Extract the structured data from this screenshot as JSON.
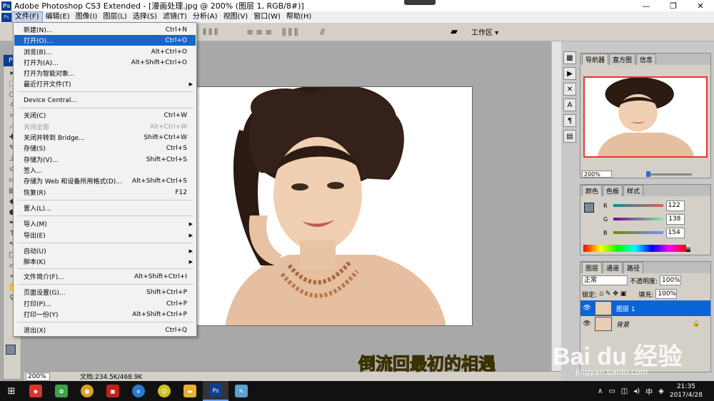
{
  "window": {
    "title": "Adobe Photoshop CS3 Extended - [漫画处理.jpg @ 200% (图层 1, RGB/8#)]",
    "app_icon": "Ps",
    "minimize": "—",
    "maximize": "❐",
    "close": "✕"
  },
  "menubar": {
    "items": [
      "文件(F)",
      "编辑(E)",
      "图像(I)",
      "图层(L)",
      "选择(S)",
      "滤镜(T)",
      "分析(A)",
      "视图(V)",
      "窗口(W)",
      "帮助(H)"
    ]
  },
  "optionsbar": {
    "workspace_label": "工作区 ▾"
  },
  "file_menu": {
    "items": [
      {
        "label": "新建(N)...",
        "shortcut": "Ctrl+N"
      },
      {
        "label": "打开(O)...",
        "shortcut": "Ctrl+O",
        "highlighted": true
      },
      {
        "label": "浏览(B)...",
        "shortcut": "Alt+Ctrl+O"
      },
      {
        "label": "打开为(A)...",
        "shortcut": "Alt+Shift+Ctrl+O"
      },
      {
        "label": "打开为智能对象...",
        "shortcut": ""
      },
      {
        "label": "最近打开文件(T)",
        "shortcut": "",
        "submenu": true
      },
      {
        "label": "Device Central...",
        "shortcut": ""
      },
      {
        "label": "关闭(C)",
        "shortcut": "Ctrl+W"
      },
      {
        "label": "关闭全部",
        "shortcut": "Alt+Ctrl+W",
        "disabled": true
      },
      {
        "label": "关闭并转到 Bridge...",
        "shortcut": "Shift+Ctrl+W"
      },
      {
        "label": "存储(S)",
        "shortcut": "Ctrl+S"
      },
      {
        "label": "存储为(V)...",
        "shortcut": "Shift+Ctrl+S"
      },
      {
        "label": "签入...",
        "shortcut": ""
      },
      {
        "label": "存储为 Web 和设备所用格式(D)...",
        "shortcut": "Alt+Shift+Ctrl+S"
      },
      {
        "label": "恢复(R)",
        "shortcut": "F12"
      },
      {
        "label": "置入(L)...",
        "shortcut": ""
      },
      {
        "label": "导入(M)",
        "shortcut": "",
        "submenu": true
      },
      {
        "label": "导出(E)",
        "shortcut": "",
        "submenu": true
      },
      {
        "label": "自动(U)",
        "shortcut": "",
        "submenu": true
      },
      {
        "label": "脚本(K)",
        "shortcut": "",
        "submenu": true
      },
      {
        "label": "文件简介(F)...",
        "shortcut": "Alt+Shift+Ctrl+I"
      },
      {
        "label": "页面设置(G)...",
        "shortcut": "Shift+Ctrl+P"
      },
      {
        "label": "打印(P)...",
        "shortcut": "Ctrl+P"
      },
      {
        "label": "打印一份(Y)",
        "shortcut": "Alt+Shift+Ctrl+P"
      },
      {
        "label": "退出(X)",
        "shortcut": "Ctrl+Q"
      }
    ]
  },
  "document": {
    "zoom": "200%",
    "info": "文档:234.5K/468.9K"
  },
  "navigator": {
    "tabs": [
      "导航器",
      "直方图",
      "信息"
    ],
    "zoom": "200%"
  },
  "color_panel": {
    "tabs": [
      "颜色",
      "色板",
      "样式"
    ],
    "foreground_color": "#7a8a9a",
    "channels": [
      {
        "label": "R",
        "value": "122",
        "color": "#d04040"
      },
      {
        "label": "G",
        "value": "138",
        "color": "#40a040"
      },
      {
        "label": "B",
        "value": "154",
        "color": "#4040d0"
      }
    ]
  },
  "layers_panel": {
    "tabs": [
      "图层",
      "通道",
      "路径"
    ],
    "blend_mode": "正常",
    "opacity_label": "不透明度:",
    "opacity": "100%",
    "lock_label": "锁定:",
    "fill_label": "填充:",
    "fill": "100%",
    "layers": [
      {
        "name": "图层 1",
        "selected": true
      },
      {
        "name": "背景",
        "locked": true
      }
    ]
  },
  "overlay": {
    "caption": "倒流回最初的相遇",
    "watermark": "Bai du 经验",
    "watermark_url": "jingyan.baidu.com"
  },
  "taskbar": {
    "apps": [
      "app-1",
      "app-2",
      "chrome",
      "app-4",
      "app-5",
      "app-6",
      "file-explorer",
      "photoshop",
      "app-9"
    ],
    "ime": "中",
    "time": "21:35",
    "date": "2017/4/28"
  }
}
